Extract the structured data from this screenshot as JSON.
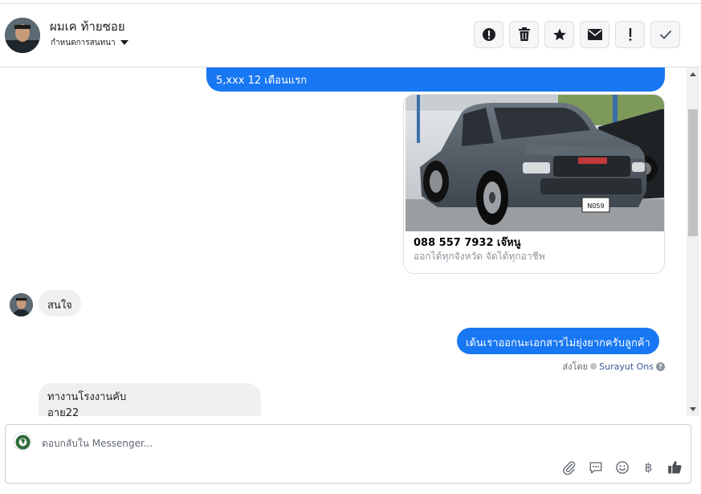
{
  "header": {
    "contact_name": "ผมเค ท้ายซอย",
    "assign_label": "กำหนดการสนทนา",
    "tools": [
      {
        "name": "spam-icon"
      },
      {
        "name": "trash-icon"
      },
      {
        "name": "star-icon"
      },
      {
        "name": "mail-icon"
      },
      {
        "name": "important-icon"
      },
      {
        "name": "check-icon"
      }
    ]
  },
  "messages": {
    "out_top": "5,xxx  12 เดือนแรก",
    "card": {
      "plate": "N059",
      "title": "088 557 7932 เจ๊หนู",
      "description": "ออกได้ทุกจังหวัด จัดได้ทุกอาชีพ"
    },
    "in_1": "สนใจ",
    "out_2": "เด้นเราออกนะเอกสารไม่ยุ่งยากครับลูกค้า",
    "sent_by_label": "ส่งโดย",
    "sent_by_name": "Surayut Ons",
    "in_2_line1": "ทางานโรงงานคับ",
    "in_2_line2": "อาย22"
  },
  "composer": {
    "placeholder": "ตอบกลับใน Messenger...",
    "baht_symbol": "฿",
    "icons": [
      "attachment-icon",
      "saved-reply-icon",
      "emoji-icon",
      "payment-icon",
      "like-icon"
    ]
  },
  "colors": {
    "messenger_blue": "#1877f2",
    "incoming_bubble": "#f0f0f0",
    "border": "#dddfe2"
  }
}
